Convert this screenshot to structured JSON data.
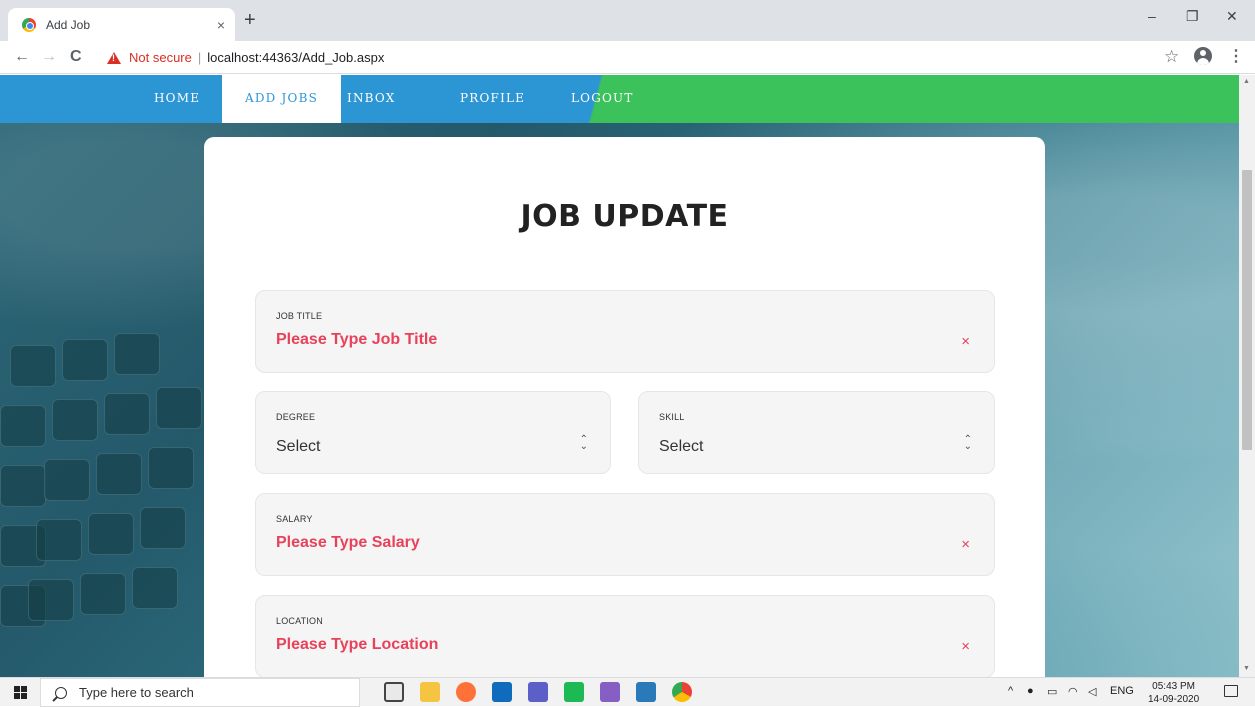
{
  "browser": {
    "tab_title": "Add Job",
    "tab_close": "×",
    "new_tab": "+",
    "minimize": "–",
    "maximize": "❐",
    "close": "✕",
    "security_label": "Not secure",
    "separator": "|",
    "url": "localhost:44363/Add_Job.aspx",
    "back": "←",
    "forward": "→",
    "reload": "C",
    "bookmark": "☆",
    "menu": "⋮"
  },
  "nav": {
    "items": [
      {
        "label": "HOME",
        "active": false
      },
      {
        "label": "ADD JOBS",
        "active": true
      },
      {
        "label": "INBOX",
        "active": false
      },
      {
        "label": "PROFILE",
        "active": false
      },
      {
        "label": "LOGOUT",
        "active": false
      }
    ]
  },
  "form": {
    "title": "JOB UPDATE",
    "job_title": {
      "label": "JOB TITLE",
      "value": "Please Type Job Title",
      "clear": "×"
    },
    "degree": {
      "label": "DEGREE",
      "value": "Select"
    },
    "skill": {
      "label": "SKILL",
      "value": "Select"
    },
    "salary": {
      "label": "SALARY",
      "value": "Please Type Salary",
      "clear": "×"
    },
    "location": {
      "label": "LOCATION",
      "value": "Please Type Location",
      "clear": "×"
    }
  },
  "taskbar": {
    "search_placeholder": "Type here to search",
    "language": "ENG",
    "time": "05:43 PM",
    "date": "14-09-2020",
    "tray_arrow": "^"
  },
  "colors": {
    "nav_blue": "#2c96d4",
    "nav_green": "#3cc25a",
    "error_red": "#e8425a"
  }
}
